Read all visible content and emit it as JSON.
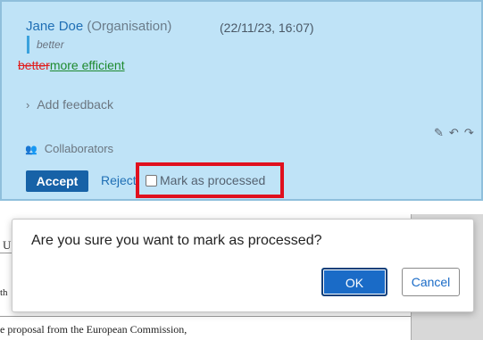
{
  "suggestion": {
    "author_name": "Jane Doe",
    "author_org": "(Organisation)",
    "timestamp": "(22/11/23, 16:07)",
    "quoted_text": "better",
    "deleted_text": "better",
    "inserted_text": "more efficient",
    "add_feedback_label": "Add feedback",
    "collaborators_label": "Collaborators",
    "accept_label": "Accept",
    "reject_label": "Reject",
    "mark_processed_label": "Mark as processed",
    "mark_processed_checked": false
  },
  "document": {
    "partial_heading": "U",
    "partial_line": "th",
    "body_text": "e proposal from the European Commission,"
  },
  "dialog": {
    "message": "Are you sure you want to mark as processed?",
    "ok_label": "OK",
    "cancel_label": "Cancel"
  },
  "colors": {
    "card_background": "#bfe3f7",
    "accent_blue": "#1762a7",
    "highlight_red": "#e0101e",
    "deleted_red": "#e02020",
    "inserted_green": "#1e8a2e"
  }
}
